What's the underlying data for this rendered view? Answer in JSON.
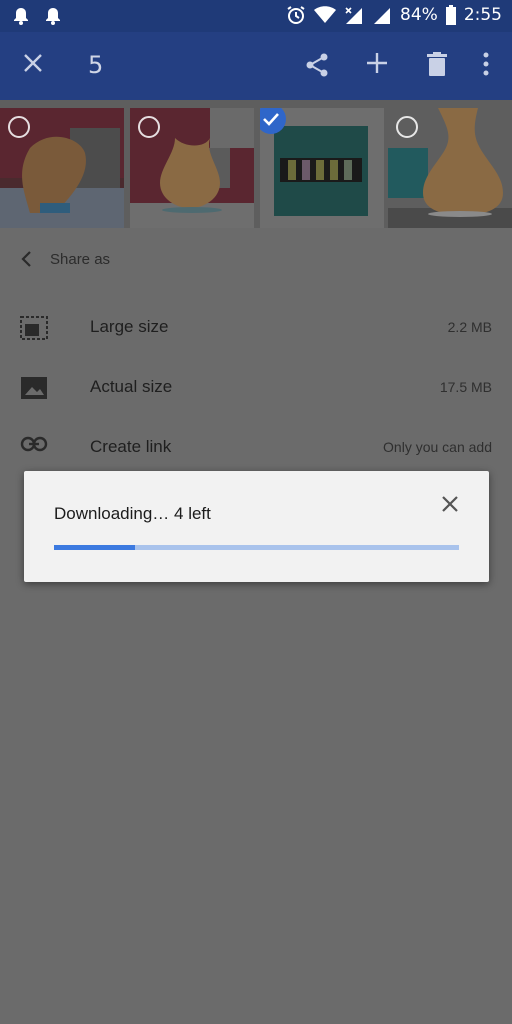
{
  "status_bar": {
    "battery_text": "84%",
    "time": "2:55",
    "icons": [
      "alarm-icon",
      "alarm-icon",
      "alarm-clock-icon",
      "wifi-icon",
      "cell-signal-icon",
      "cell-signal-icon",
      "battery-icon"
    ]
  },
  "app_bar": {
    "selected_count": "5",
    "icons": [
      "close-icon",
      "share-icon",
      "add-icon",
      "delete-icon",
      "more-vert-icon"
    ]
  },
  "thumbnails": [
    {
      "name": "vase-photo",
      "selected": false
    },
    {
      "name": "diffuser-photo",
      "selected": false
    },
    {
      "name": "oils-box-photo",
      "selected": true
    },
    {
      "name": "diffuser-closeup-photo",
      "selected": false
    }
  ],
  "share_sheet": {
    "title": "Share as",
    "options": [
      {
        "label": "Large size",
        "value": "2.2 MB",
        "icon": "resize-image-icon"
      },
      {
        "label": "Actual size",
        "value": "17.5 MB",
        "icon": "image-icon"
      },
      {
        "label": "Create link",
        "value": "Only you can add",
        "icon": "link-icon"
      }
    ]
  },
  "download_dialog": {
    "message": "Downloading… 4 left",
    "progress": 0.2
  },
  "colors": {
    "status_bar": "#1f3a78",
    "app_bar": "#243f82",
    "accent": "#3c7ae0",
    "progress_track": "#a9c3ec",
    "scrim": "#6b6b6b"
  }
}
